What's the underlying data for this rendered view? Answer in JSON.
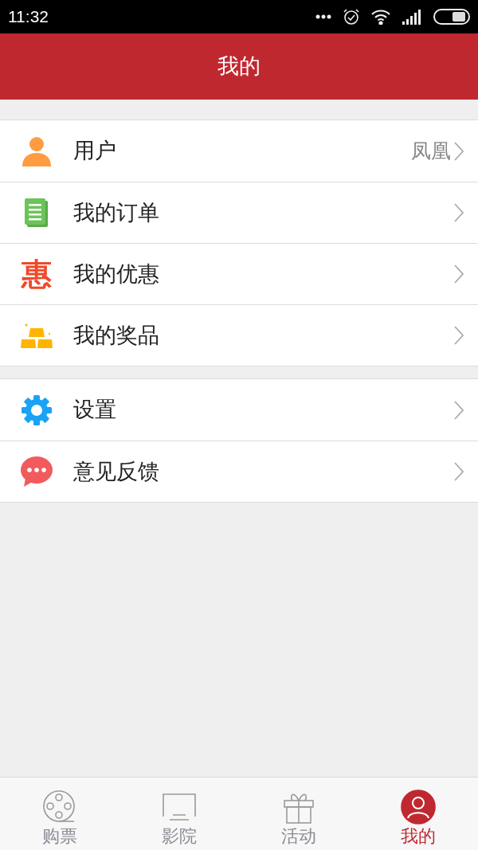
{
  "status_bar": {
    "time": "11:32"
  },
  "header": {
    "title": "我的"
  },
  "groups": [
    {
      "items": [
        {
          "kind": "user",
          "label": "用户",
          "value": "凤凰"
        },
        {
          "kind": "orders",
          "label": "我的订单"
        },
        {
          "kind": "discount",
          "icon_text": "惠",
          "label": "我的优惠"
        },
        {
          "kind": "prize",
          "label": "我的奖品"
        }
      ]
    },
    {
      "items": [
        {
          "kind": "settings",
          "label": "设置"
        },
        {
          "kind": "feedback",
          "label": "意见反馈"
        }
      ]
    }
  ],
  "tab_bar": [
    {
      "kind": "film",
      "label": "购票",
      "selected": false
    },
    {
      "kind": "screen",
      "label": "影院",
      "selected": false
    },
    {
      "kind": "gift",
      "label": "活动",
      "selected": false
    },
    {
      "kind": "person",
      "label": "我的",
      "selected": true
    }
  ]
}
